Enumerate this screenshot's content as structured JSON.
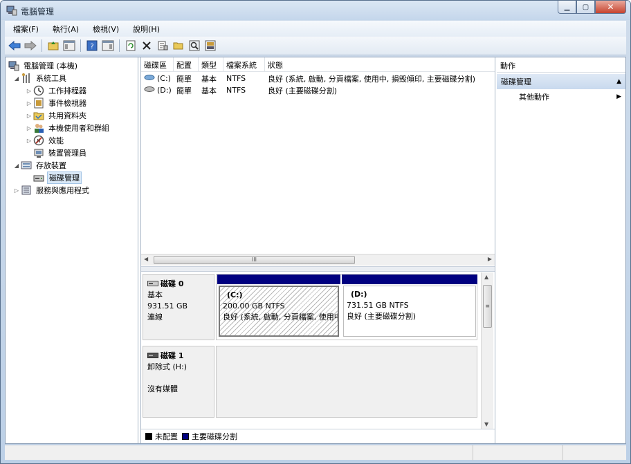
{
  "window": {
    "title": "電腦管理"
  },
  "menu": [
    {
      "label": "檔案(F)"
    },
    {
      "label": "執行(A)"
    },
    {
      "label": "檢視(V)"
    },
    {
      "label": "說明(H)"
    }
  ],
  "tree": {
    "root": "電腦管理 (本機)",
    "system_tools": "系統工具",
    "task_scheduler": "工作排程器",
    "event_viewer": "事件檢視器",
    "shared_folders": "共用資料夾",
    "local_users": "本機使用者和群組",
    "performance": "效能",
    "device_manager": "裝置管理員",
    "storage": "存放裝置",
    "disk_management": "磁碟管理",
    "services_apps": "服務與應用程式"
  },
  "volumes": {
    "headers": [
      "磁碟區",
      "配置",
      "類型",
      "檔案系統",
      "狀態"
    ],
    "rows": [
      {
        "name": "(C:)",
        "layout": "簡單",
        "type": "基本",
        "fs": "NTFS",
        "status": "良好 (系統, 啟動, 分頁檔案, 使用中, 損毀傾印, 主要磁碟分割)"
      },
      {
        "name": "(D:)",
        "layout": "簡單",
        "type": "基本",
        "fs": "NTFS",
        "status": "良好 (主要磁碟分割)"
      }
    ]
  },
  "hscroll_thumb": "III",
  "vscroll_thumb": "≡",
  "disks": [
    {
      "name": "磁碟 0",
      "type": "基本",
      "size": "931.51 GB",
      "status": "連線",
      "partitions": [
        {
          "label": "(C:)",
          "size": "200.00 GB NTFS",
          "status": "良好 (系統, 啟動, 分頁檔案, 使用中, 損毀傾印, 主要磁碟分割)"
        },
        {
          "label": "(D:)",
          "size": "731.51 GB NTFS",
          "status": "良好 (主要磁碟分割)"
        }
      ]
    },
    {
      "name": "磁碟 1",
      "type": "卸除式 (H:)",
      "status": "沒有媒體"
    }
  ],
  "legend": [
    {
      "label": "未配置",
      "color": "#000000"
    },
    {
      "label": "主要磁碟分割",
      "color": "#000080"
    }
  ],
  "actions": {
    "header": "動作",
    "section": "磁碟管理",
    "more": "其他動作"
  }
}
